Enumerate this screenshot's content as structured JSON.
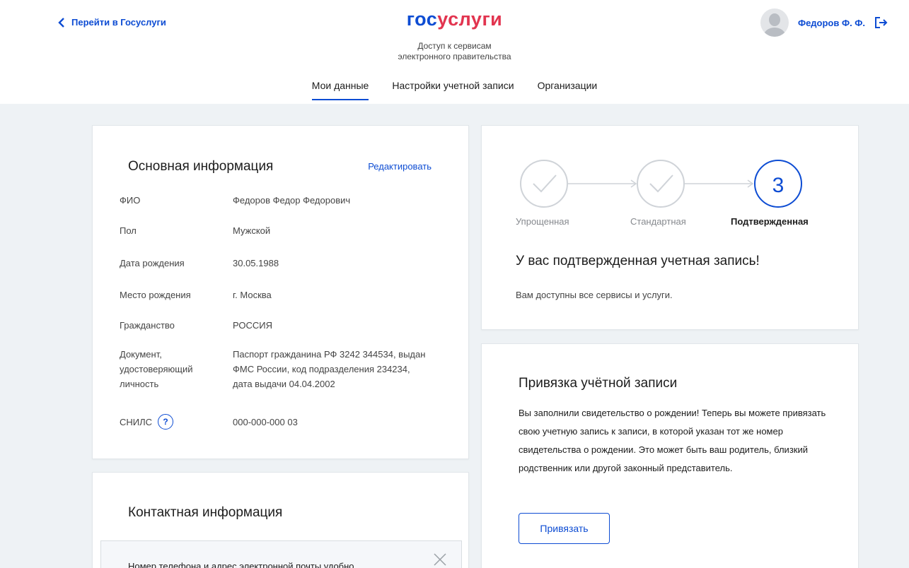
{
  "header": {
    "back_link": "Перейти в Госуслуги",
    "logo_part1": "гос",
    "logo_part2": "услуги",
    "subtitle_line1": "Доступ к сервисам",
    "subtitle_line2": "электронного правительства",
    "user_name": "Федоров Ф. Ф.",
    "icons": {
      "back": "chevron-left-icon",
      "logout": "logout-icon",
      "avatar": "user-avatar-icon"
    }
  },
  "tabs": [
    {
      "label": "Мои данные",
      "active": true
    },
    {
      "label": "Настройки учетной записи",
      "active": false
    },
    {
      "label": "Организации",
      "active": false
    }
  ],
  "basic_info": {
    "title": "Основная информация",
    "edit_label": "Редактировать",
    "rows": [
      {
        "label": "ФИО",
        "value": "Федоров Федор Федорович"
      },
      {
        "label": "Пол",
        "value": "Мужской"
      },
      {
        "label": "Дата рождения",
        "value": "30.05.1988"
      },
      {
        "label": "Место рождения",
        "value": "г. Москва"
      },
      {
        "label": "Гражданство",
        "value": "РОССИЯ"
      },
      {
        "label": "Документ, удостоверяющий личность",
        "value": "Паспорт гражданина РФ 3242 344534, выдан ФМС России, код подразделения 234234, дата выдачи 04.04.2002"
      }
    ],
    "snils_label": "СНИЛС",
    "snils_help": "?",
    "snils_value": "000-000-000 03"
  },
  "account_level": {
    "steps": [
      "Упрощенная",
      "Стандартная",
      "Подтвержденная"
    ],
    "current_step_number": "3",
    "title": "У вас подтвержденная учетная запись!",
    "text": "Вам доступны все сервисы и услуги."
  },
  "account_link": {
    "title": "Привязка учётной записи",
    "text": "Вы заполнили свидетельство о рождении! Теперь вы можете привязать свою учетную запись к записи, в которой указан тот же номер свидетельства о рождении. Это может быть ваш родитель, близкий родственник или другой законный представитель.",
    "button_label": "Привязать"
  },
  "contact_info": {
    "title": "Контактная информация",
    "notice_text": "Номер телефона и адрес электронной почты удобно"
  },
  "colors": {
    "accent": "#0d4cd3",
    "brand_red": "#e2344f",
    "background": "#eef2f5",
    "step_done": "#cfd3d8"
  }
}
